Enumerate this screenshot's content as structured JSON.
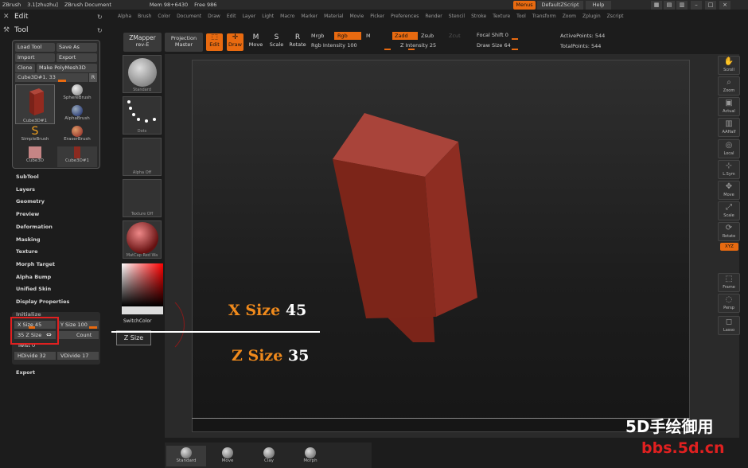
{
  "titlebar": {
    "app": "ZBrush",
    "version": "3.1[zhuzhu]",
    "document": "ZBrush Document",
    "mem": "Mem 98+6430",
    "free": "Free 986",
    "menus": "Menus",
    "default_script": "DefaultZScript",
    "help": "Help"
  },
  "menubar": [
    "Alpha",
    "Brush",
    "Color",
    "Document",
    "Draw",
    "Edit",
    "Layer",
    "Light",
    "Macro",
    "Marker",
    "Material",
    "Movie",
    "Picker",
    "Preferences",
    "Render",
    "Stencil",
    "Stroke",
    "Texture",
    "Tool",
    "Transform",
    "Zoom",
    "Zplugin",
    "Zscript"
  ],
  "palettes": {
    "edit": "Edit",
    "tool": "Tool"
  },
  "tool_palette": {
    "load_tool": "Load Tool",
    "save_as": "Save As",
    "import": "Import",
    "export": "Export",
    "clone": "Clone",
    "make_polymesh": "Make PolyMesh3D",
    "current_tool": "Cube3D#1. 33",
    "r_button": "R",
    "thumbs": [
      "Cube3D#1",
      "SphereBrush",
      "AlphaBrush",
      "SimpleBrush",
      "EraserBrush",
      "Cube3D",
      "Cube3D#1"
    ]
  },
  "subpalettes": [
    "SubTool",
    "Layers",
    "Geometry",
    "Preview",
    "Deformation",
    "Masking",
    "Texture",
    "Morph Target",
    "Alpha Bump",
    "Unified Skin",
    "Display Properties"
  ],
  "initialize": {
    "label": "Initialize",
    "x_size": "X Size 45",
    "y_size": "Y Size 100",
    "z_size": "35 Z Size",
    "count": "Count",
    "twist": "Twist 0",
    "hdivide": "HDivide 32",
    "vdivide": "VDivide 17",
    "export": "Export"
  },
  "tooltip": "Z Size",
  "left_shelf": {
    "zmapper": "ZMapper",
    "rev": "rev-E",
    "projection": "Projection",
    "master": "Master",
    "materials": [
      "Standard",
      "Dots",
      "Alpha Off",
      "Texture Off",
      "MatCap Red Wa"
    ],
    "switch_color": "SwitchColor"
  },
  "top_controls": {
    "edit": "Edit",
    "draw": "Draw",
    "move": "Move",
    "scale": "Scale",
    "rotate": "Rotate",
    "mrgb": "Mrgb",
    "rgb": "Rgb",
    "m": "M",
    "rgb_intensity": "Rgb Intensity 100",
    "zadd": "Zadd",
    "zsub": "Zsub",
    "zcut": "Zcut",
    "z_intensity": "Z Intensity 25",
    "focal_shift": "Focal Shift 0",
    "draw_size": "Draw Size 64",
    "active_points": "ActivePoints: 544",
    "total_points": "TotalPoints: 544"
  },
  "right_tools": [
    "Scroll",
    "Zoom",
    "Actual",
    "AAHalf",
    "Local",
    "L.Sym",
    "Move",
    "Scale",
    "Rotate",
    "Frame",
    "Persp",
    "Lasso"
  ],
  "xyz": "XYZ",
  "bottom_brushes": [
    "Standard",
    "Move",
    "Clay",
    "Morph"
  ],
  "annotations": {
    "x_size_label": "X Size",
    "x_size_value": "45",
    "z_size_label": "Z Size",
    "z_size_value": "35"
  },
  "watermark": {
    "line1": "5D手绘御用",
    "line2": "bbs.5d.cn"
  },
  "colors": {
    "accent": "#e86a10",
    "model": "#8b2a20",
    "annotation_orange": "#f08a1c",
    "highlight_red": "#e02020"
  }
}
